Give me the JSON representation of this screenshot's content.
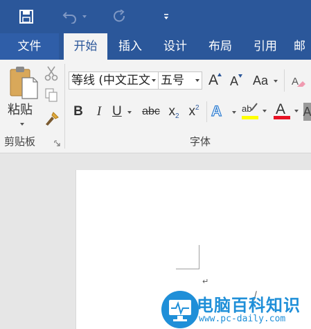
{
  "tabs": {
    "file": "文件",
    "home": "开始",
    "insert": "插入",
    "design": "设计",
    "layout": "布局",
    "references": "引用",
    "mailings": "邮"
  },
  "clipboard": {
    "paste_label": "粘贴",
    "group_label": "剪贴板"
  },
  "font": {
    "name_value": "等线 (中文正文",
    "size_value": "五号",
    "grow_label": "A",
    "shrink_label": "A",
    "case_label": "Aa",
    "bold_label": "B",
    "italic_label": "I",
    "underline_label": "U",
    "strike_label": "abc",
    "subscript_label": "x",
    "subscript_mark": "2",
    "superscript_label": "x",
    "superscript_mark": "2",
    "effects_label": "A",
    "highlight_label": "ab",
    "font_color_label": "A",
    "group_label": "字体"
  },
  "document": {
    "paragraph_mark": "↵"
  },
  "watermark": {
    "text": "电脑百科知识",
    "url": "www.pc-daily.com"
  },
  "colors": {
    "title_bar": "#2b579a",
    "highlight": "#ffff00",
    "font_color": "#e81123",
    "watermark": "#1f8fd8"
  }
}
